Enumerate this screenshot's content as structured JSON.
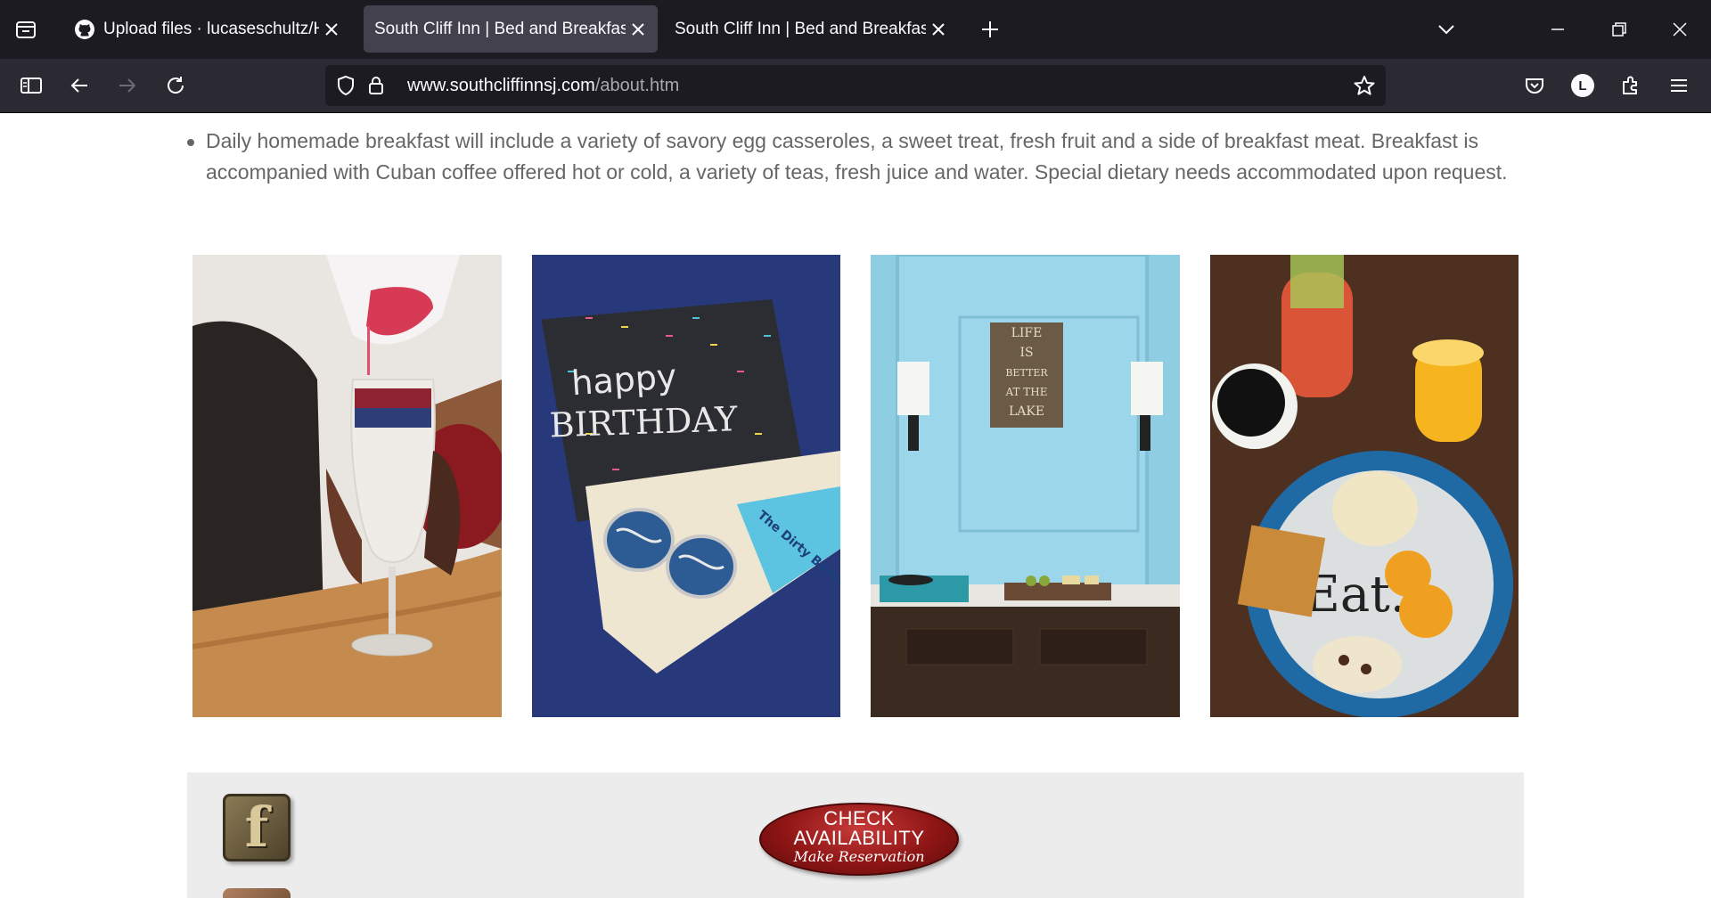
{
  "browser": {
    "tabs": [
      {
        "title": "Upload files · lucaseschultz/HTT",
        "favicon": "github-icon"
      },
      {
        "title": "South Cliff Inn | Bed and Breakfast |",
        "favicon": "none"
      },
      {
        "title": "South Cliff Inn | Bed and Breakfast |",
        "favicon": "none"
      }
    ],
    "active_tab": 1,
    "url": {
      "domain": "www.southcliffinnsj.com",
      "path": "/about.htm"
    },
    "account_initial": "L",
    "colors": {
      "tabbar": "#1c1b22",
      "toolbar": "#2b2a33",
      "active_tab": "#42414d",
      "text": "#fbfbfe"
    }
  },
  "content": {
    "bullets": [
      "Daily homemade breakfast will include a variety of savory egg casseroles, a sweet treat, fresh fruit and a side of breakfast meat. Breakfast is accompanied with Cuban coffee offered hot or cold, a variety of teas, fresh juice and water. Special dietary needs accommodated upon request."
    ],
    "photos": {
      "birthday_card_line1": "happy",
      "birthday_card_line2": "BIRTHDAY",
      "pastry_box_label": "The Dirty Baker",
      "wall_sign": [
        "LIFE",
        "IS",
        "BETTER",
        "AT THE",
        "LAKE"
      ],
      "plate_text": "Eat."
    },
    "footer": {
      "facebook_glyph": "f",
      "check_line1": "CHECK",
      "check_line2": "AVAILABILITY",
      "check_line3": "Make Reservation"
    }
  }
}
